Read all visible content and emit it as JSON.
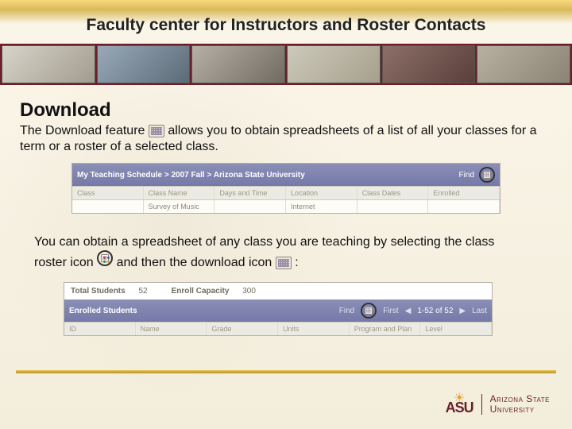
{
  "title": "Faculty center for Instructors and Roster Contacts",
  "section_heading": "Download",
  "para1_a": "The Download feature ",
  "para1_b": " allows you to obtain spreadsheets of a list of all your classes for a term or a roster of a selected class.",
  "para2_a": "You can obtain a spreadsheet of any class you are teaching by selecting the class roster icon ",
  "para2_b": " and then the download icon ",
  "para2_c": " :",
  "shot1": {
    "breadcrumb": "My Teaching Schedule > 2007 Fall > Arizona State University",
    "find": "Find",
    "cols": [
      "Class",
      "Class Name",
      "Days and Time",
      "Location",
      "Class Dates",
      "Enrolled"
    ],
    "row": [
      "",
      "Survey of Music",
      "",
      "Internet",
      "",
      ""
    ]
  },
  "shot2": {
    "total_label": "Total Students",
    "total_val": "52",
    "cap_label": "Enroll Capacity",
    "cap_val": "300",
    "bar_title": "Enrolled Students",
    "find": "Find",
    "first": "First",
    "page": "1-52 of 52",
    "last": "Last",
    "cols": [
      "ID",
      "Name",
      "Grade",
      "Units",
      "Program and Plan",
      "Level"
    ]
  },
  "logo": {
    "mark": "ASU",
    "line1": "Arizona State",
    "line2": "University"
  }
}
